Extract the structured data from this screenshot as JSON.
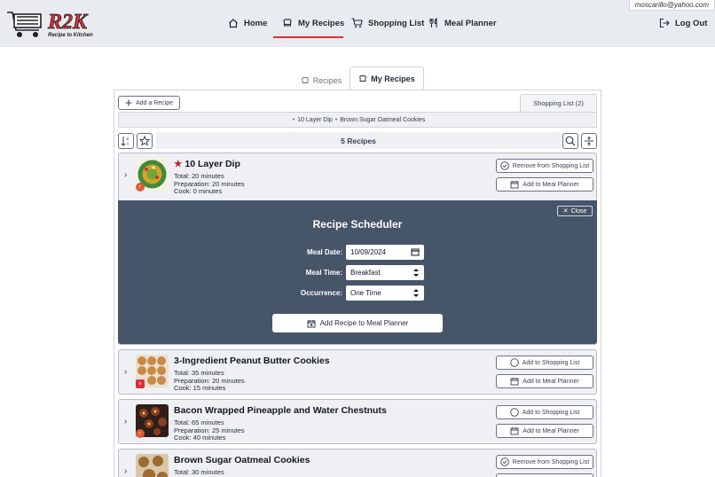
{
  "user": {
    "email": "moscarillo@yahoo.com"
  },
  "brand": {
    "logo_text": "R2K",
    "tagline": "Recipe to Kitchen",
    "accent": "#d9313b"
  },
  "nav": {
    "home": "Home",
    "my_recipes": "My Recipes",
    "shopping_list": "Shopping List",
    "meal_planner": "Meal Planner",
    "logout": "Log Out"
  },
  "tabs": {
    "recipes": "Recipes",
    "my_recipes": "My Recipes"
  },
  "toolbar": {
    "add_recipe": "Add a Recipe",
    "shopping_tab": "Shopping List (2)",
    "shopping_items": [
      "10 Layer Dip",
      "Brown Sugar Oatmeal Cookies"
    ],
    "count": "5 Recipes"
  },
  "recipes": [
    {
      "title": "10 Layer Dip",
      "favorite": true,
      "total": "Total: 20 minutes",
      "prep": "Preparation: 20 minutes",
      "cook": "Cook: 0 minutes",
      "shop_btn": "Remove from Shopping List",
      "planner_btn": "Add to Meal Planner"
    },
    {
      "title": "3-Ingredient Peanut Butter Cookies",
      "total": "Total: 35 minutes",
      "prep": "Preparation: 20 minutes",
      "cook": "Cook: 15 minutes",
      "shop_btn": "Add to Shopping List",
      "planner_btn": "Add to Meal Planner"
    },
    {
      "title": "Bacon Wrapped Pineapple and Water Chestnuts",
      "total": "Total: 65 minutes",
      "prep": "Preparation: 25 minutes",
      "cook": "Cook: 40 minutes",
      "shop_btn": "Add to Shopping List",
      "planner_btn": "Add to Meal Planner"
    },
    {
      "title": "Brown Sugar Oatmeal Cookies",
      "total": "Total: 30 minutes",
      "shop_btn": "Remove from Shopping List"
    }
  ],
  "scheduler": {
    "title": "Recipe Scheduler",
    "close": "Close",
    "date_label": "Meal Date:",
    "date_value": "10/09/2024",
    "time_label": "Meal Time:",
    "time_value": "Breakfast",
    "occurrence_label": "Occurrence:",
    "occurrence_value": "One Time",
    "submit": "Add Recipe to Meal Planner"
  }
}
